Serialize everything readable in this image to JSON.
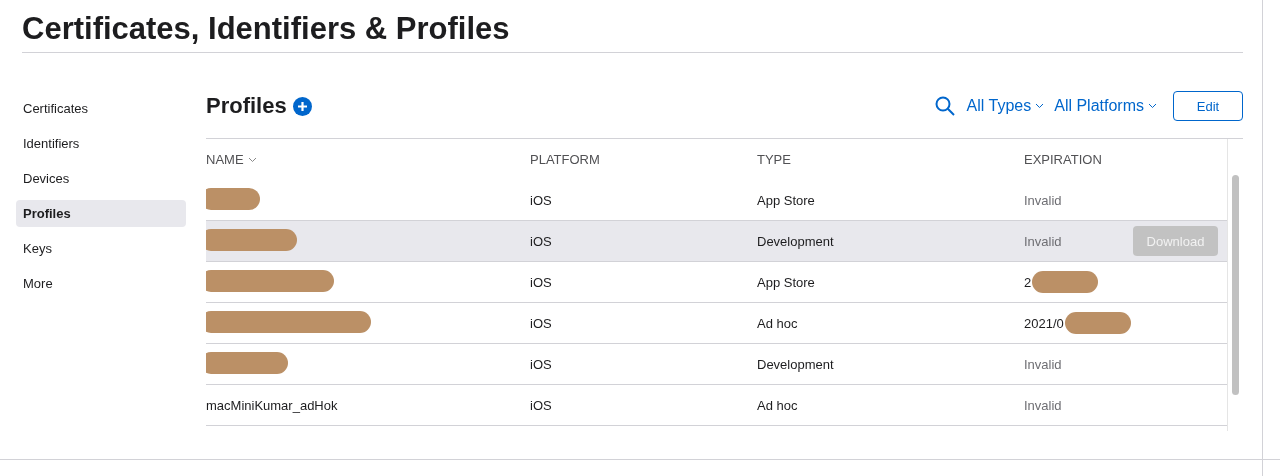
{
  "page_title": "Certificates, Identifiers & Profiles",
  "sidebar": {
    "items": [
      {
        "label": "Certificates",
        "selected": false
      },
      {
        "label": "Identifiers",
        "selected": false
      },
      {
        "label": "Devices",
        "selected": false
      },
      {
        "label": "Profiles",
        "selected": true
      },
      {
        "label": "Keys",
        "selected": false
      },
      {
        "label": "More",
        "selected": false
      }
    ]
  },
  "section_title": "Profiles",
  "filters": [
    "All Types",
    "All Platforms"
  ],
  "edit_button": "Edit",
  "table": {
    "columns": [
      "NAME",
      "PLATFORM",
      "TYPE",
      "EXPIRATION"
    ],
    "rows": [
      {
        "name_redacted": true,
        "platform": "iOS",
        "type": "App Store",
        "expiration": "Invalid",
        "valid": false,
        "selected": false
      },
      {
        "name_redacted": true,
        "platform": "iOS",
        "type": "Development",
        "expiration": "Invalid",
        "valid": false,
        "selected": true,
        "action": {
          "label": "Download",
          "disabled": true
        }
      },
      {
        "name_redacted": true,
        "platform": "iOS",
        "type": "App Store",
        "expiration": "2",
        "expiration_redacted": true,
        "valid": true,
        "selected": false
      },
      {
        "name_redacted": true,
        "platform": "iOS",
        "type": "Ad hoc",
        "expiration": "2021/0",
        "expiration_redacted": true,
        "valid": true,
        "selected": false
      },
      {
        "name_redacted": true,
        "platform": "iOS",
        "type": "Development",
        "expiration": "Invalid",
        "valid": false,
        "selected": false
      },
      {
        "name": "macMiniKumar_adHok",
        "name_redacted": false,
        "platform": "iOS",
        "type": "Ad hoc",
        "expiration": "Invalid",
        "valid": false,
        "selected": false
      }
    ]
  }
}
